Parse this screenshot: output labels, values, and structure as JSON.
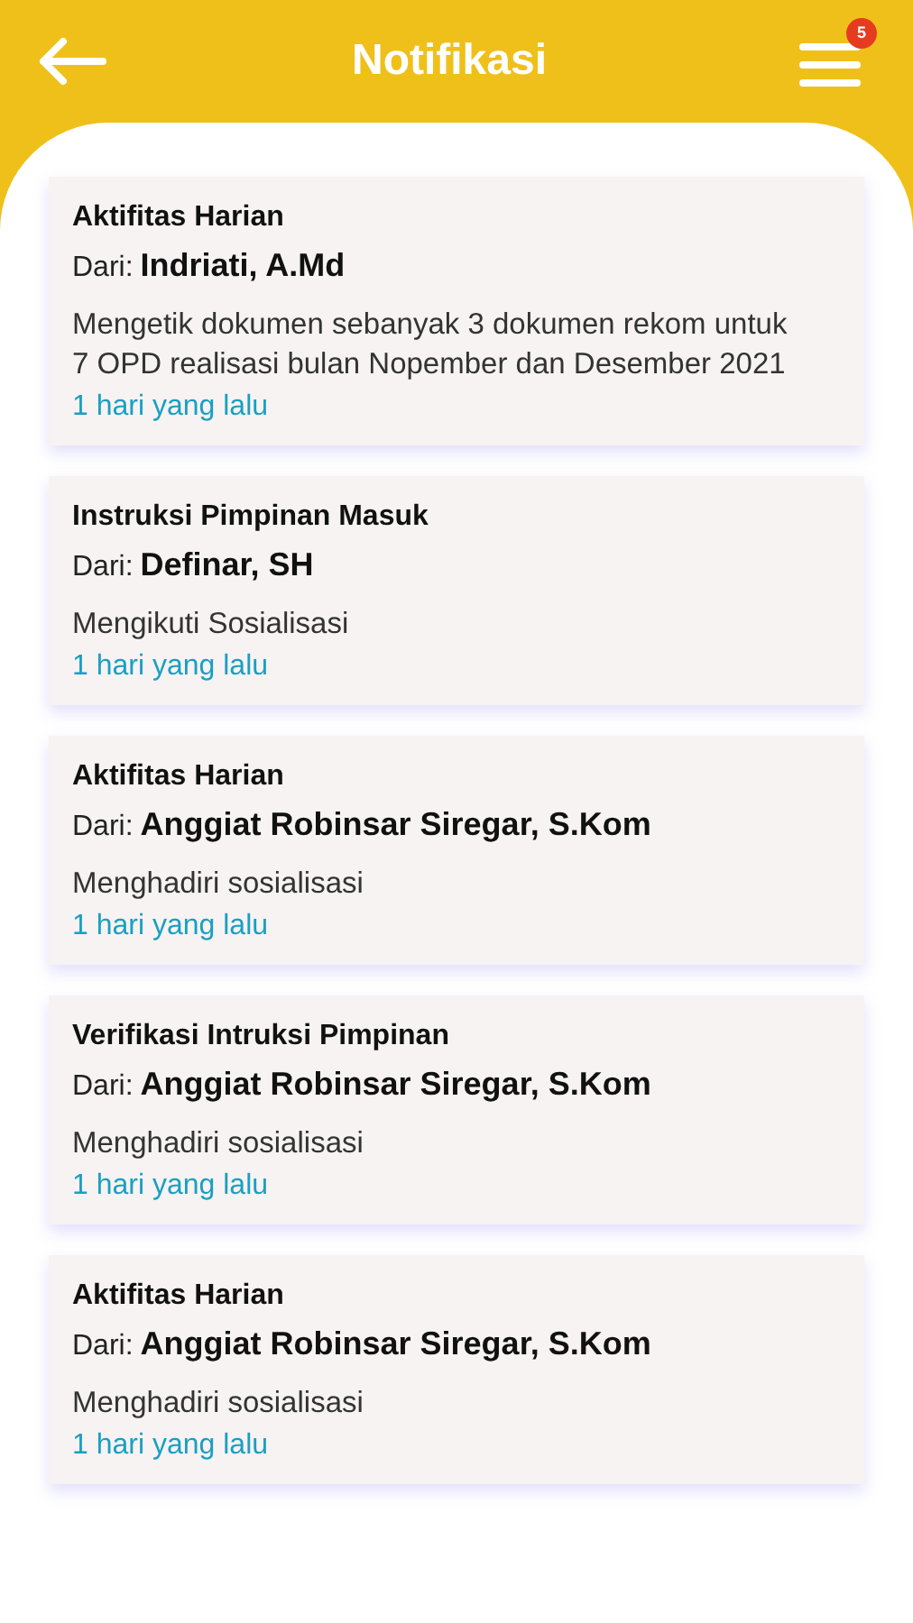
{
  "header": {
    "title": "Notifikasi",
    "badge": "5"
  },
  "notifications": [
    {
      "category": "Aktifitas Harian",
      "from_label": "Dari:",
      "sender": "Indriati, A.Md",
      "message": "Mengetik dokumen sebanyak 3 dokumen rekom untuk 7 OPD realisasi bulan Nopember dan Desember 2021",
      "time": "1 hari yang lalu"
    },
    {
      "category": "Instruksi Pimpinan Masuk",
      "from_label": "Dari:",
      "sender": "Definar, SH",
      "message": "Mengikuti Sosialisasi",
      "time": "1 hari yang lalu"
    },
    {
      "category": "Aktifitas Harian",
      "from_label": "Dari:",
      "sender": "Anggiat Robinsar Siregar, S.Kom",
      "message": "Menghadiri sosialisasi",
      "time": "1 hari yang lalu"
    },
    {
      "category": "Verifikasi Intruksi Pimpinan",
      "from_label": "Dari:",
      "sender": "Anggiat Robinsar Siregar, S.Kom",
      "message": "Menghadiri sosialisasi",
      "time": "1 hari yang lalu"
    },
    {
      "category": "Aktifitas Harian",
      "from_label": "Dari:",
      "sender": "Anggiat Robinsar Siregar, S.Kom",
      "message": "Menghadiri sosialisasi",
      "time": "1 hari yang lalu"
    }
  ]
}
